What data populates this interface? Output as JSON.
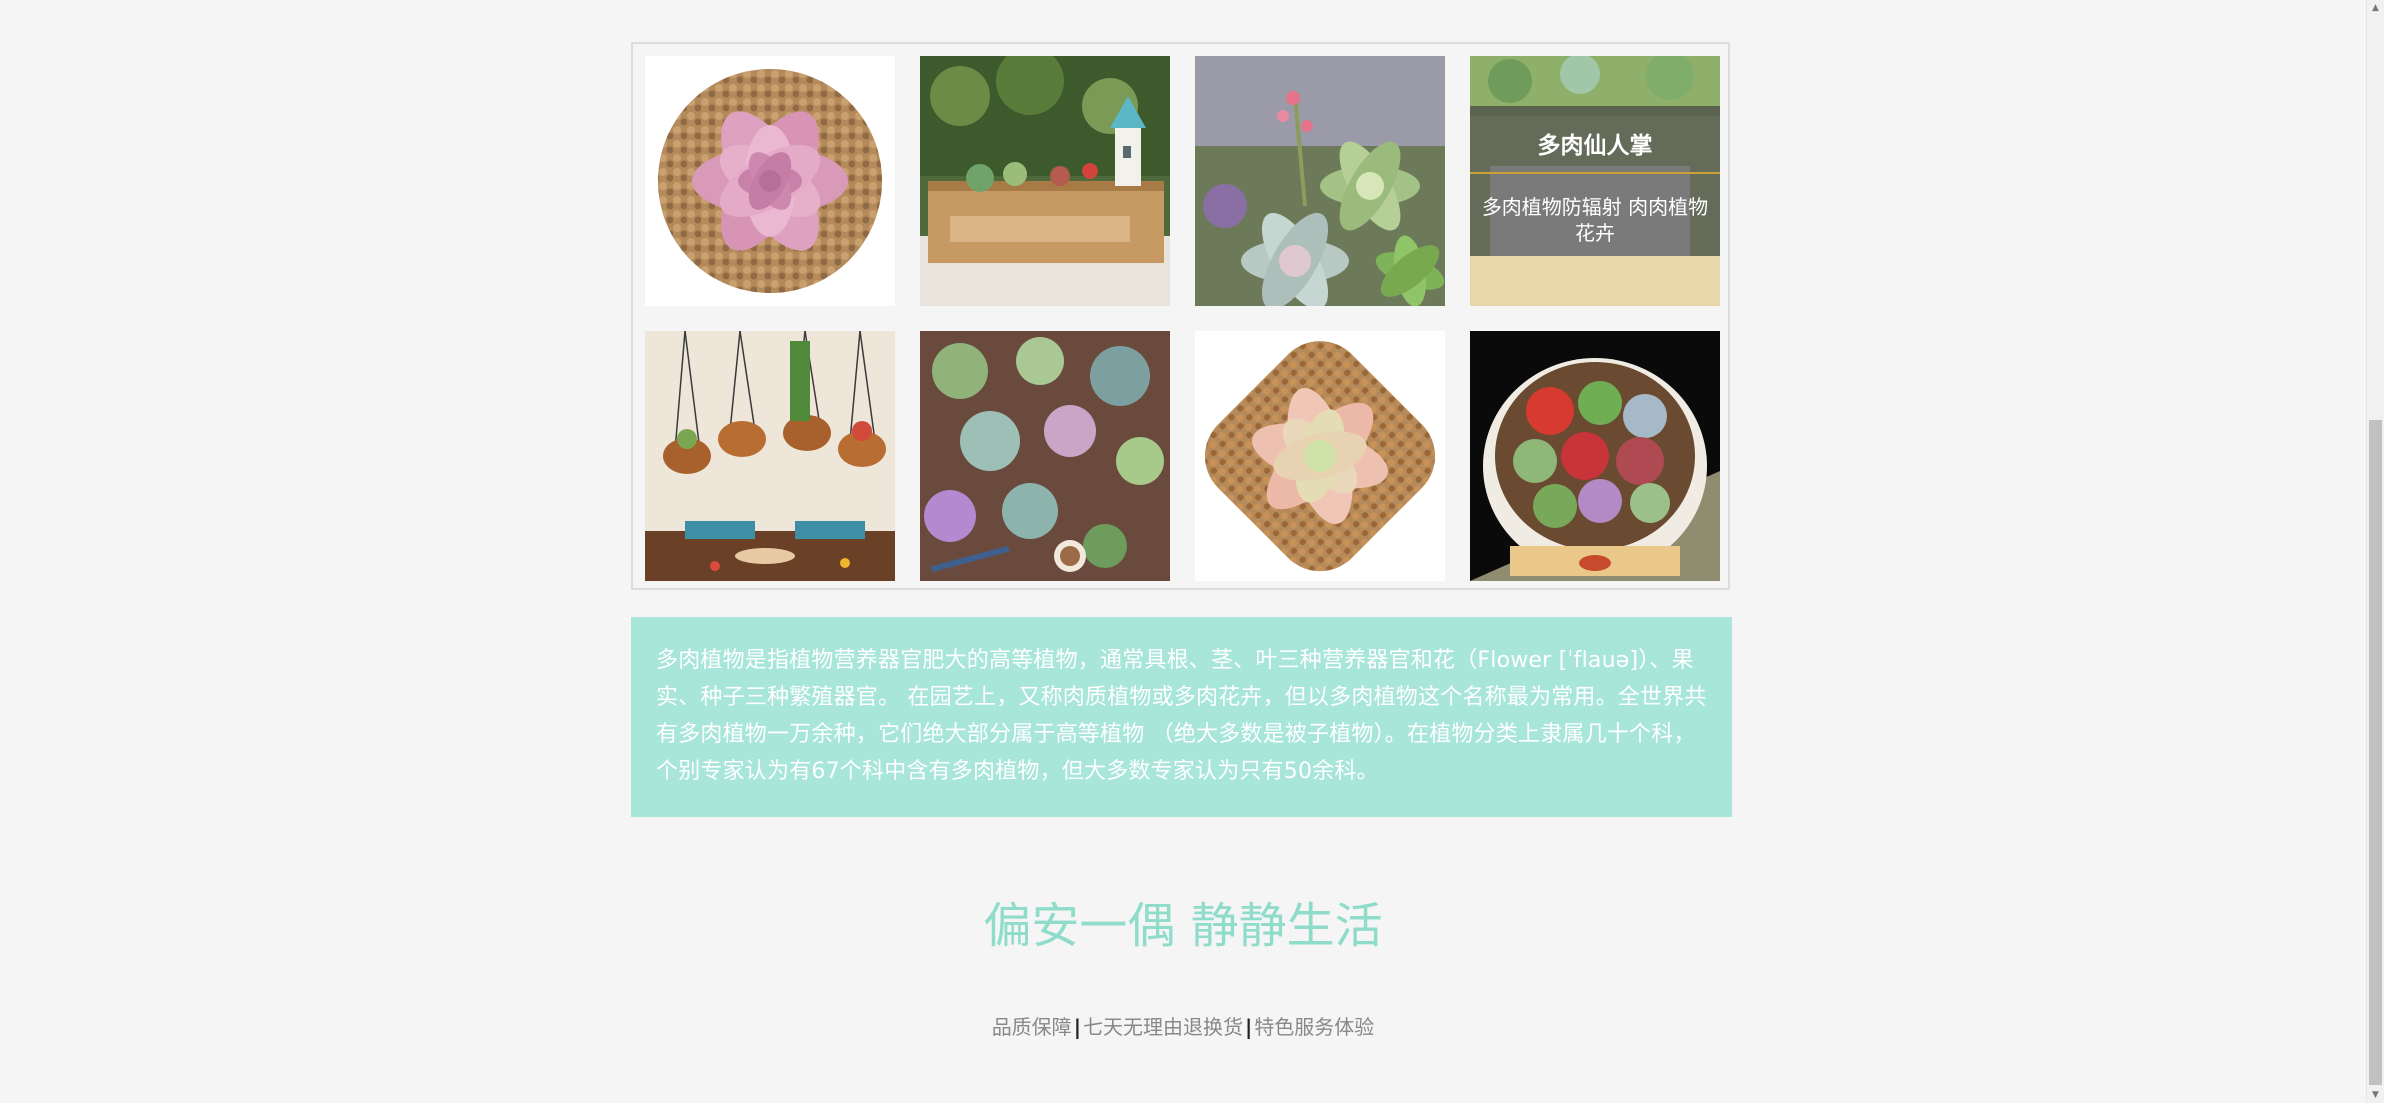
{
  "gallery": {
    "items": [
      {
        "image": "pink-echeveria-in-pebble-pot"
      },
      {
        "image": "succulent-garden-in-wooden-crate"
      },
      {
        "image": "flowering-succulent-arrangement"
      },
      {
        "image": "succulents-in-green-pot",
        "overlay": {
          "title": "多肉仙人掌",
          "desc": "多肉植物防辐射 肉肉植物花卉"
        }
      },
      {
        "image": "hanging-copper-pots-with-succulents"
      },
      {
        "image": "assorted-succulents-flatlay"
      },
      {
        "image": "peach-echeveria-in-pebble-pot"
      },
      {
        "image": "round-bowl-of-colorful-succulents"
      }
    ]
  },
  "description": {
    "text": "多肉植物是指植物营养器官肥大的高等植物，通常具根、茎、叶三种营养器官和花（Flower [ˈflauə]）、果实、种子三种繁殖器官。 在园艺上，又称肉质植物或多肉花卉，但以多肉植物这个名称最为常用。全世界共有多肉植物一万余种，它们绝大部分属于高等植物 （绝大多数是被子植物）。在植物分类上隶属几十个科，个别专家认为有67个科中含有多肉植物，但大多数专家认为只有50余科。"
  },
  "slogan": "偏安一偶 静静生活",
  "footer": {
    "links": [
      "品质保障",
      "七天无理由退换货",
      "特色服务体验"
    ],
    "separator": "|"
  },
  "colors": {
    "background": "#f5f5f5",
    "desc_box": "#a8e6d9",
    "slogan": "#8fdccb",
    "overlay_line": "#c8a232"
  }
}
